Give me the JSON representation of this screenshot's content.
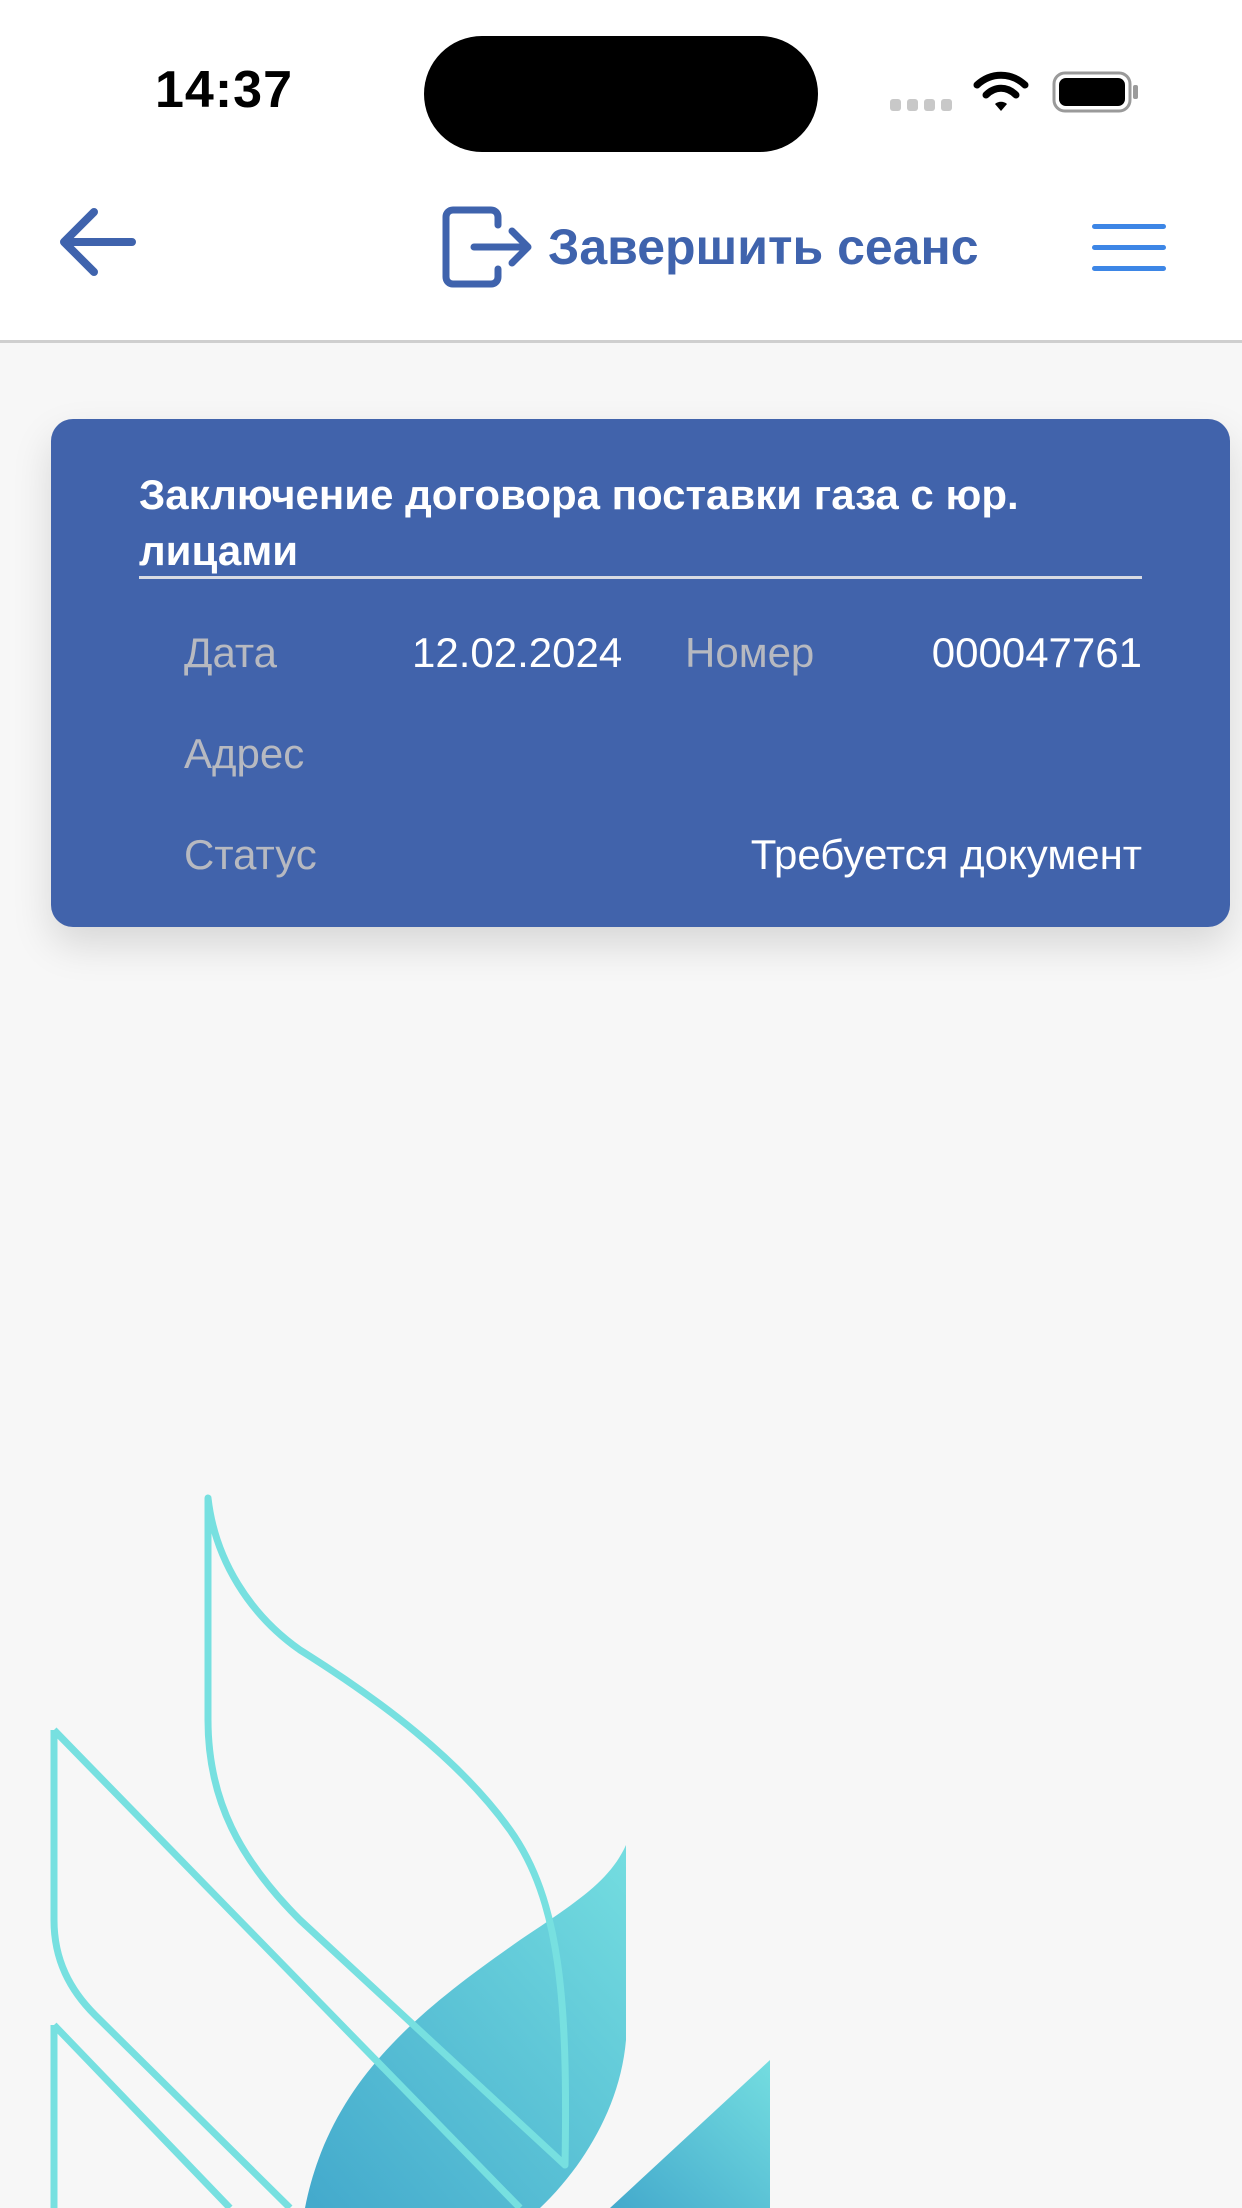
{
  "status_bar": {
    "time": "14:37"
  },
  "nav": {
    "back_icon": "arrow-left-icon",
    "logout_icon": "logout-icon",
    "logout_label": "Завершить сеанс",
    "menu_icon": "hamburger-menu-icon",
    "accent_color": "#3f63ad"
  },
  "card": {
    "title": "Заключение договора поставки газа с юр. лицами",
    "date_label": "Дата",
    "date_value": "12.02.2024",
    "number_label": "Номер",
    "number_value": "000047761",
    "address_label": "Адрес",
    "address_value": "",
    "status_label": "Статус",
    "status_value": "Требуется документ",
    "background_color": "#4163ab"
  },
  "background": {
    "logo": "flame-logo"
  }
}
